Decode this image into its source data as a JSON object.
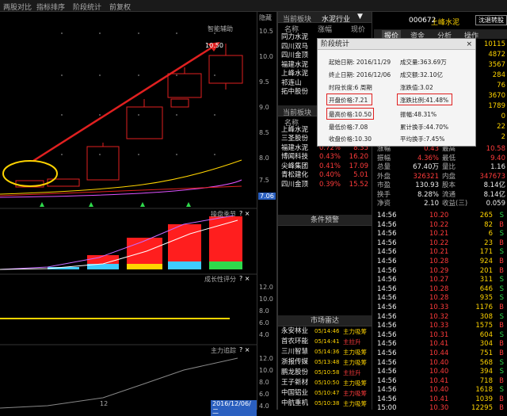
{
  "topbar": {
    "items": [
      "两股对比",
      "指标排序",
      "阶段统计",
      "前复权"
    ],
    "bitmap_note": ""
  },
  "chart": {
    "main_label": "智能辅助",
    "high_label": "10.50",
    "y_labels": [
      "10.5",
      "10.0",
      "9.5",
      "9.0",
      "8.5",
      "8.0",
      "7.5",
      "7.0"
    ],
    "price_tag": "7.06",
    "sub1_label": "操盘季节",
    "sub2_label": "成长性评分",
    "sub3_label": "主力追踪",
    "sub_ticks_icons": "? ×",
    "sub2_y": [
      "12.0",
      "10.0",
      "8.0",
      "6.0",
      "4.0"
    ],
    "sub3_y": [
      "12.0",
      "10.0",
      "8.0",
      "6.0",
      "4.0"
    ],
    "bottom_num": "12",
    "bottom_date": "2016/12/06/二",
    "hidden_label": "隐藏"
  },
  "mid": {
    "title": "当前板块",
    "industry": "水泥行业",
    "cols": [
      "名称",
      "涨幅",
      "现价"
    ],
    "rows1": [
      {
        "n": "同力水泥",
        "z": "",
        "p": ""
      },
      {
        "n": "四川双马",
        "z": "",
        "p": ""
      },
      {
        "n": "四川金顶",
        "z": "",
        "p": ""
      },
      {
        "n": "福建水泥",
        "z": "",
        "p": ""
      },
      {
        "n": "上峰水泥",
        "z": "",
        "p": ""
      },
      {
        "n": "祁连山",
        "z": "",
        "p": ""
      },
      {
        "n": "拓中股份",
        "z": "",
        "p": ""
      }
    ],
    "title2": "当前板块",
    "rows2": [
      {
        "n": "上峰水泥",
        "z": "",
        "p": ""
      },
      {
        "n": "三圣股份",
        "z": "0.73%",
        "p": "23.58"
      },
      {
        "n": "福建水泥",
        "z": "0.72%",
        "p": "8.35"
      },
      {
        "n": "博闻科技",
        "z": "0.43%",
        "p": "16.20"
      },
      {
        "n": "尖峰集团",
        "z": "0.41%",
        "p": "17.09"
      },
      {
        "n": "青松建化",
        "z": "0.40%",
        "p": "5.01"
      },
      {
        "n": "四川金顶",
        "z": "0.39%",
        "p": "15.52"
      }
    ],
    "cond": "条件预警",
    "market": "市场雷达",
    "radar": [
      {
        "n": "永安林业",
        "t": "05/14:46",
        "e": "主力吸筹",
        "c": "yel"
      },
      {
        "n": "首农环能",
        "t": "05/14:41",
        "e": "主拉升",
        "c": "red"
      },
      {
        "n": "三川智慧",
        "t": "05/14:36",
        "e": "主力吸筹",
        "c": "yel"
      },
      {
        "n": "浙报传媒",
        "t": "05/13:48",
        "e": "主力吸筹",
        "c": "yel"
      },
      {
        "n": "鹏龙股份",
        "t": "05/10:58",
        "e": "主拉升",
        "c": "red"
      },
      {
        "n": "王子新材",
        "t": "05/10:50",
        "e": "主力吸筹",
        "c": "yel"
      },
      {
        "n": "中国铝业",
        "t": "05/10:47",
        "e": "主力吸筹",
        "c": "red"
      },
      {
        "n": "中航重机",
        "t": "05/10:38",
        "e": "主力吸筹",
        "c": "yel"
      }
    ]
  },
  "right": {
    "code": "000672",
    "name": "上峰水泥",
    "btn": "沈退转股",
    "tabs": [
      "报价",
      "资金",
      "分析",
      "操作"
    ],
    "side_vals": [
      "10115",
      "4872",
      "3567",
      "284",
      "76",
      "3670",
      "1789",
      "0",
      "22",
      "2"
    ],
    "quote": [
      {
        "l": "涨幅",
        "v": "0.43",
        "l2": "最高",
        "v2": "10.58",
        "c": "red"
      },
      {
        "l": "振幅",
        "v": "4.36%",
        "l2": "最低",
        "v2": "9.40",
        "c": "red"
      },
      {
        "l": "总量",
        "v": "67.40万",
        "l2": "量比",
        "v2": "1.16",
        "c": "wht"
      },
      {
        "l": "外盘",
        "v": "326321",
        "l2": "内盘",
        "v2": "347673",
        "c": "red"
      },
      {
        "l": "市盈",
        "v": "130.93",
        "l2": "股本",
        "v2": "8.14亿",
        "c": "wht"
      },
      {
        "l": "换手",
        "v": "8.28%",
        "l2": "流通",
        "v2": "8.14亿",
        "c": "wht"
      },
      {
        "l": "净资",
        "v": "2.10",
        "l2": "收益(三)",
        "v2": "0.059",
        "c": "wht"
      }
    ],
    "ticks": [
      {
        "t": "14:56",
        "p": "10.20",
        "v": "265",
        "s": "S"
      },
      {
        "t": "14:56",
        "p": "10.22",
        "v": "82",
        "s": "B"
      },
      {
        "t": "14:56",
        "p": "10.21",
        "v": "6",
        "s": "S"
      },
      {
        "t": "14:56",
        "p": "10.22",
        "v": "23",
        "s": "B"
      },
      {
        "t": "14:56",
        "p": "10.21",
        "v": "171",
        "s": "S"
      },
      {
        "t": "14:56",
        "p": "10.28",
        "v": "924",
        "s": "B"
      },
      {
        "t": "14:56",
        "p": "10.29",
        "v": "201",
        "s": "B"
      },
      {
        "t": "14:56",
        "p": "10.27",
        "v": "311",
        "s": "S"
      },
      {
        "t": "14:56",
        "p": "10.28",
        "v": "646",
        "s": "S"
      },
      {
        "t": "14:56",
        "p": "10.28",
        "v": "935",
        "s": "S"
      },
      {
        "t": "14:56",
        "p": "10.33",
        "v": "1176",
        "s": "B"
      },
      {
        "t": "14:56",
        "p": "10.32",
        "v": "308",
        "s": "S"
      },
      {
        "t": "14:56",
        "p": "10.33",
        "v": "1575",
        "s": "B"
      },
      {
        "t": "14:56",
        "p": "10.31",
        "v": "604",
        "s": "S"
      },
      {
        "t": "14:56",
        "p": "10.41",
        "v": "304",
        "s": "B"
      },
      {
        "t": "14:56",
        "p": "10.44",
        "v": "751",
        "s": "B"
      },
      {
        "t": "14:56",
        "p": "10.40",
        "v": "568",
        "s": "S"
      },
      {
        "t": "14:56",
        "p": "10.40",
        "v": "394",
        "s": "S"
      },
      {
        "t": "14:56",
        "p": "10.41",
        "v": "718",
        "s": "B"
      },
      {
        "t": "14:56",
        "p": "10.40",
        "v": "1618",
        "s": "S"
      },
      {
        "t": "14:56",
        "p": "10.41",
        "v": "1039",
        "s": "B"
      },
      {
        "t": "15:00",
        "p": "10.30",
        "v": "12295",
        "s": "B"
      }
    ]
  },
  "dialog": {
    "title": "阶段统计",
    "start_l": "起始日期:",
    "start_v": "2016/11/29",
    "end_l": "终止日期:",
    "end_v": "2016/12/06",
    "period_l": "时段长度:",
    "period_v": "6",
    "period_u": "周期",
    "vol_l": "成交量:",
    "vol_v": "363.69万",
    "amt_l": "成交额:",
    "amt_v": "32.10亿",
    "up_l": "涨跌值:",
    "up_v": "3.02",
    "open_l": "开盘价格:",
    "open_v": "7.21",
    "ratio_l": "涨跌比例:",
    "ratio_v": "41.48%",
    "high_l": "最高价格:",
    "high_v": "10.50",
    "amp_l": "振幅:",
    "amp_v": "48.31%",
    "low_l": "最低价格:",
    "low_v": "7.08",
    "turn_l": "累计换手:",
    "turn_v": "44.70%",
    "close_l": "收盘价格:",
    "close_v": "10.30",
    "avg_l": "平均换手:",
    "avg_v": "7.45%"
  },
  "colors": {
    "up": "#ff3b3b",
    "down": "#2fd94c",
    "accent": "#ffd400",
    "arrow": "#e02020"
  }
}
